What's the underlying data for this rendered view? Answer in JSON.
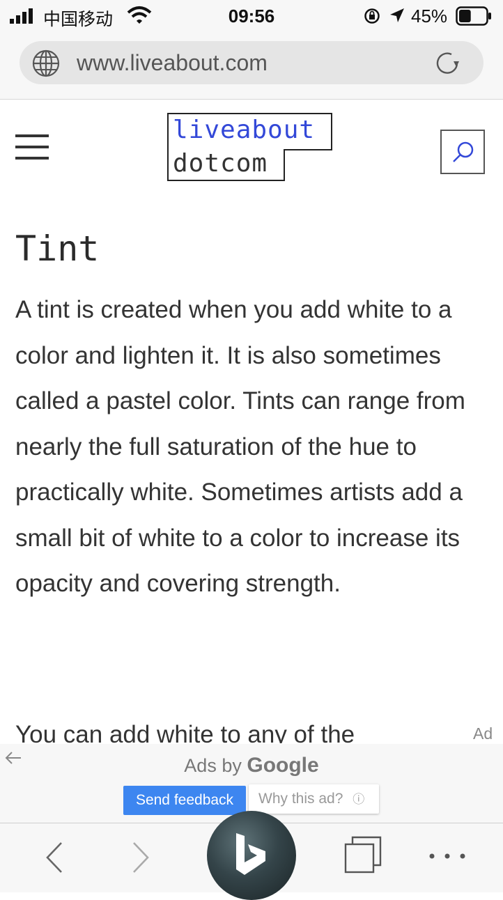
{
  "status_bar": {
    "carrier": "中国移动",
    "time": "09:56",
    "battery_percent": "45%",
    "battery_level": 0.45
  },
  "browser": {
    "url": "www.liveabout.com"
  },
  "site": {
    "logo_line1": "liveabout",
    "logo_line2": "dotcom"
  },
  "article": {
    "heading": "Tint",
    "paragraph1": "A tint is created when you add white to a color and lighten it. It is also sometimes called a pastel color. Tints can range from nearly the full saturation of the hue to practically white. Sometimes artists add a small bit of white to a color to increase its opacity and covering strength.",
    "paragraph2": "You can add white to any of the"
  },
  "ad": {
    "ad_label": "Ad",
    "ads_by": "Ads by",
    "ads_by_brand": "Google",
    "send_feedback": "Send feedback",
    "why_this_ad": "Why this ad?",
    "info_glyph": "ⓘ"
  },
  "colors": {
    "logo_accent": "#3348d8",
    "feedback_button": "#3d86f0"
  },
  "icons": {
    "menu": "hamburger-icon",
    "search": "search-icon",
    "reload": "reload-icon",
    "globe": "globe-icon",
    "bing": "bing-icon",
    "tabs": "tabs-icon",
    "more": "more-icon"
  }
}
